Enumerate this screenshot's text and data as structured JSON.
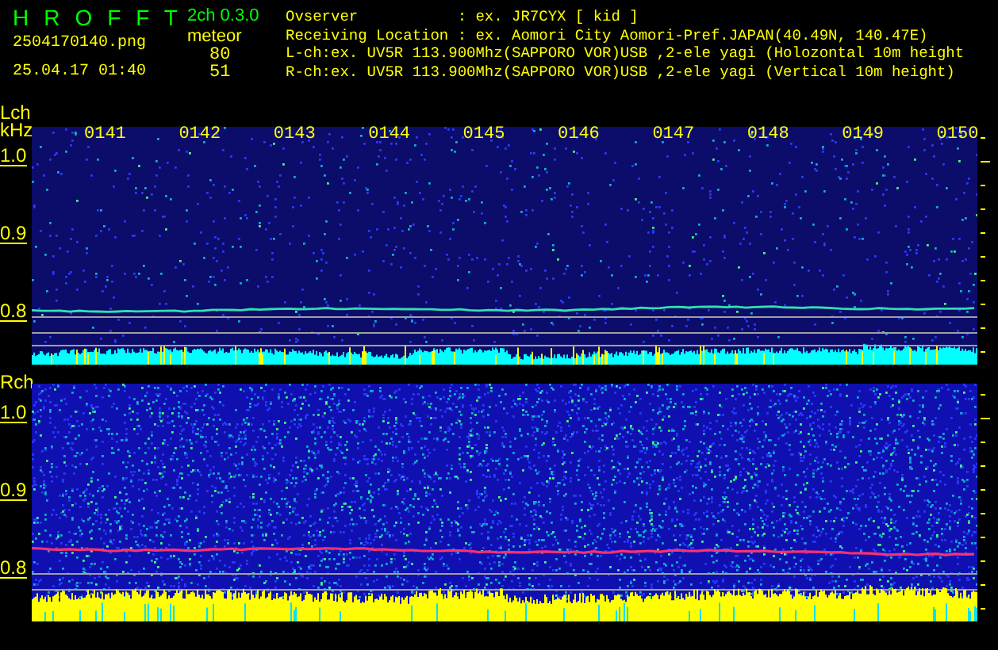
{
  "header": {
    "title": "H R O F F T",
    "version": "2ch 0.3.0",
    "file": "2504170140.png",
    "datetime": "25.04.17 01:40",
    "count_label": "meteor",
    "counts": [
      "80",
      "51"
    ],
    "info": [
      {
        "label": "Ovserver",
        "value": ": ex. JR7CYX [ kid ]"
      },
      {
        "label": "Receiving Location",
        "value": ": ex. Aomori City Aomori-Pref.JAPAN(40.49N, 140.47E)"
      }
    ],
    "channels": [
      "L-ch:ex. UV5R 113.900Mhz(SAPPORO VOR)USB ,2-ele yagi (Holozontal 10m height",
      "R-ch:ex. UV5R 113.900Mhz(SAPPORO VOR)USB ,2-ele yagi (Vertical 10m height)"
    ]
  },
  "panels": [
    {
      "name": "Lch",
      "unit": "kHz",
      "time_labels": [
        "0141",
        "0142",
        "0143",
        "0144",
        "0145",
        "0146",
        "0147",
        "0148",
        "0149",
        "0150"
      ],
      "freq_labels": [
        "1.0",
        "0.9",
        "0.8"
      ]
    },
    {
      "name": "Rch",
      "freq_labels": [
        "1.0",
        "0.9",
        "0.8"
      ]
    }
  ]
}
